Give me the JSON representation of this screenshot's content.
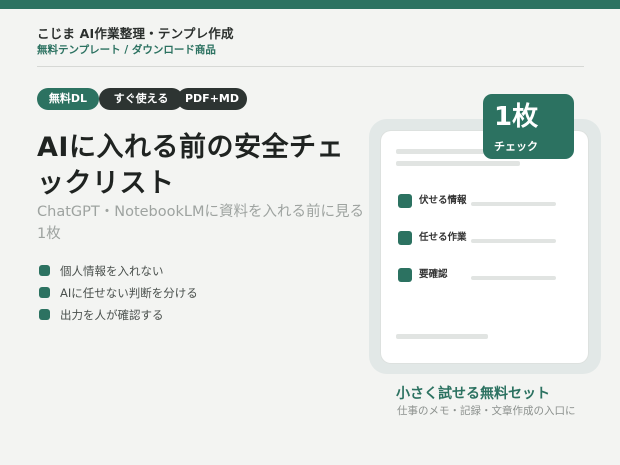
{
  "header": {
    "brand": "こじま AI作業整理・テンプレ作成",
    "subtitle": "無料テンプレート / ダウンロード商品"
  },
  "tags": [
    "無料DL",
    "すぐ使える",
    "PDF+MD"
  ],
  "main": {
    "title": "AIに入れる前の安全チェックリスト",
    "description": "ChatGPT・NotebookLMに資料を入れる前に見る1枚",
    "points": [
      "個人情報を入れない",
      "AIに任せない判断を分ける",
      "出力を人が確認する"
    ]
  },
  "preview": {
    "badge_big": "1枚",
    "badge_small": "チェック",
    "checks": [
      "伏せる情報",
      "任せる作業",
      "要確認"
    ]
  },
  "footer": {
    "tagline": "小さく試せる無料セット",
    "note": "仕事のメモ・記録・文章作成の入口に"
  },
  "colors": {
    "accent": "#2c7261",
    "dark": "#2d3432",
    "background": "#f3f4f2"
  }
}
